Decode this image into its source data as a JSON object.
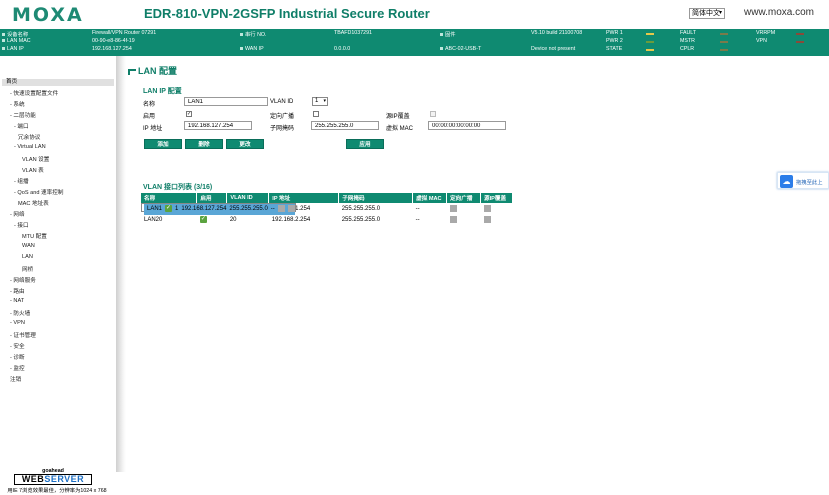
{
  "header": {
    "logo": "MOXA",
    "product_title": "EDR-810-VPN-2GSFP Industrial Secure Router",
    "language": "简体中文",
    "site": "www.moxa.com"
  },
  "status": {
    "device_name_label": "设备名称",
    "device_name": "Firewall/VPN Router 07291",
    "serial_label": "串行 NO.",
    "serial": "TBAFD1037291",
    "firmware_label": "固件",
    "firmware": "V5.10 build 21100708",
    "lan_mac_label": "LAN MAC",
    "lan_mac": "00-90-e8-86-4f-19",
    "lan_ip_label": "LAN IP",
    "lan_ip": "192.168.127.254",
    "wan_ip_label": "WAN IP",
    "wan_ip": "0.0.0.0",
    "usb_label": "ABC-02-USB-T",
    "usb_value": "Device not present",
    "pwr1": "PWR 1",
    "pwr2": "PWR 2",
    "state": "STATE",
    "fault": "FAULT",
    "mstr": "MSTR",
    "cplr": "CPLR",
    "vrrpm": "VRRPM",
    "vpn": "VPN",
    "led_colors": {
      "pwr1": "#e6c84a",
      "pwr2": "#6a9c3c",
      "state": "#e6c84a",
      "fault": "#7a7a4a",
      "mstr": "#7a7a4a",
      "cplr": "#7a7a4a",
      "vrrpm": "#8a4a3a",
      "vpn": "#8a4a3a"
    }
  },
  "sidebar": {
    "home": "首页",
    "items": [
      "- 快速设置配置文件",
      "- 系统",
      "- 二层功能",
      "- 端口",
      "冗余协议",
      "- Virtual LAN",
      "VLAN 设置",
      "VLAN 表",
      "- 组播",
      "- QoS and 速率控制",
      "MAC 地址表",
      "- 网络",
      "- 接口",
      "MTU 配置",
      "WAN",
      "LAN",
      "网桥",
      "- 网络服务",
      "- 路由",
      "- NAT",
      "- 防火墙",
      "- VPN",
      "- 证书管理",
      "- 安全",
      "- 诊断",
      "- 监控",
      "注销"
    ],
    "ws_brand": "goahead",
    "ws_web": "WEB",
    "ws_server": "SERVER",
    "ws_note": "用IE 7浏览效果最佳，分辨率为1024 x 768"
  },
  "page": {
    "title": "LAN 配置",
    "section_ip": "LAN IP 配置",
    "name_label": "名称",
    "name_value": "LAN1",
    "vlanid_label": "VLAN ID",
    "vlanid_value": "1",
    "enable_label": "启用",
    "enable_checked": true,
    "directed_bc_label": "定向广播",
    "directed_bc_checked": false,
    "src_ip_override_label": "源IP覆盖",
    "ip_label": "IP 地址",
    "ip_value": "192.168.127.254",
    "mask_label": "子网掩码",
    "mask_value": "255.255.255.0",
    "vmac_label": "虚拟 MAC",
    "vmac_value": "00:00:00:00:00:00",
    "buttons": {
      "add": "添加",
      "delete": "删除",
      "modify": "更改",
      "apply": "应用"
    },
    "table_title": "VLAN 接口列表 (3/16)",
    "columns": [
      "名称",
      "启用",
      "VLAN ID",
      "IP 地址",
      "子网掩码",
      "虚拟 MAC",
      "定向广播",
      "源IP覆盖"
    ],
    "rows": [
      {
        "name": "LAN1",
        "vid": "1",
        "ip": "192.168.127.254",
        "mask": "255.255.255.0",
        "vmac": "--",
        "selected": true
      },
      {
        "name": "LAN10",
        "vid": "10",
        "ip": "192.168.1.254",
        "mask": "255.255.255.0",
        "vmac": "--",
        "selected": false
      },
      {
        "name": "LAN20",
        "vid": "20",
        "ip": "192.168.2.254",
        "mask": "255.255.255.0",
        "vmac": "--",
        "selected": false
      }
    ]
  },
  "float_widget": {
    "label": "拖拽至此上",
    "icon": "cloud-icon"
  }
}
